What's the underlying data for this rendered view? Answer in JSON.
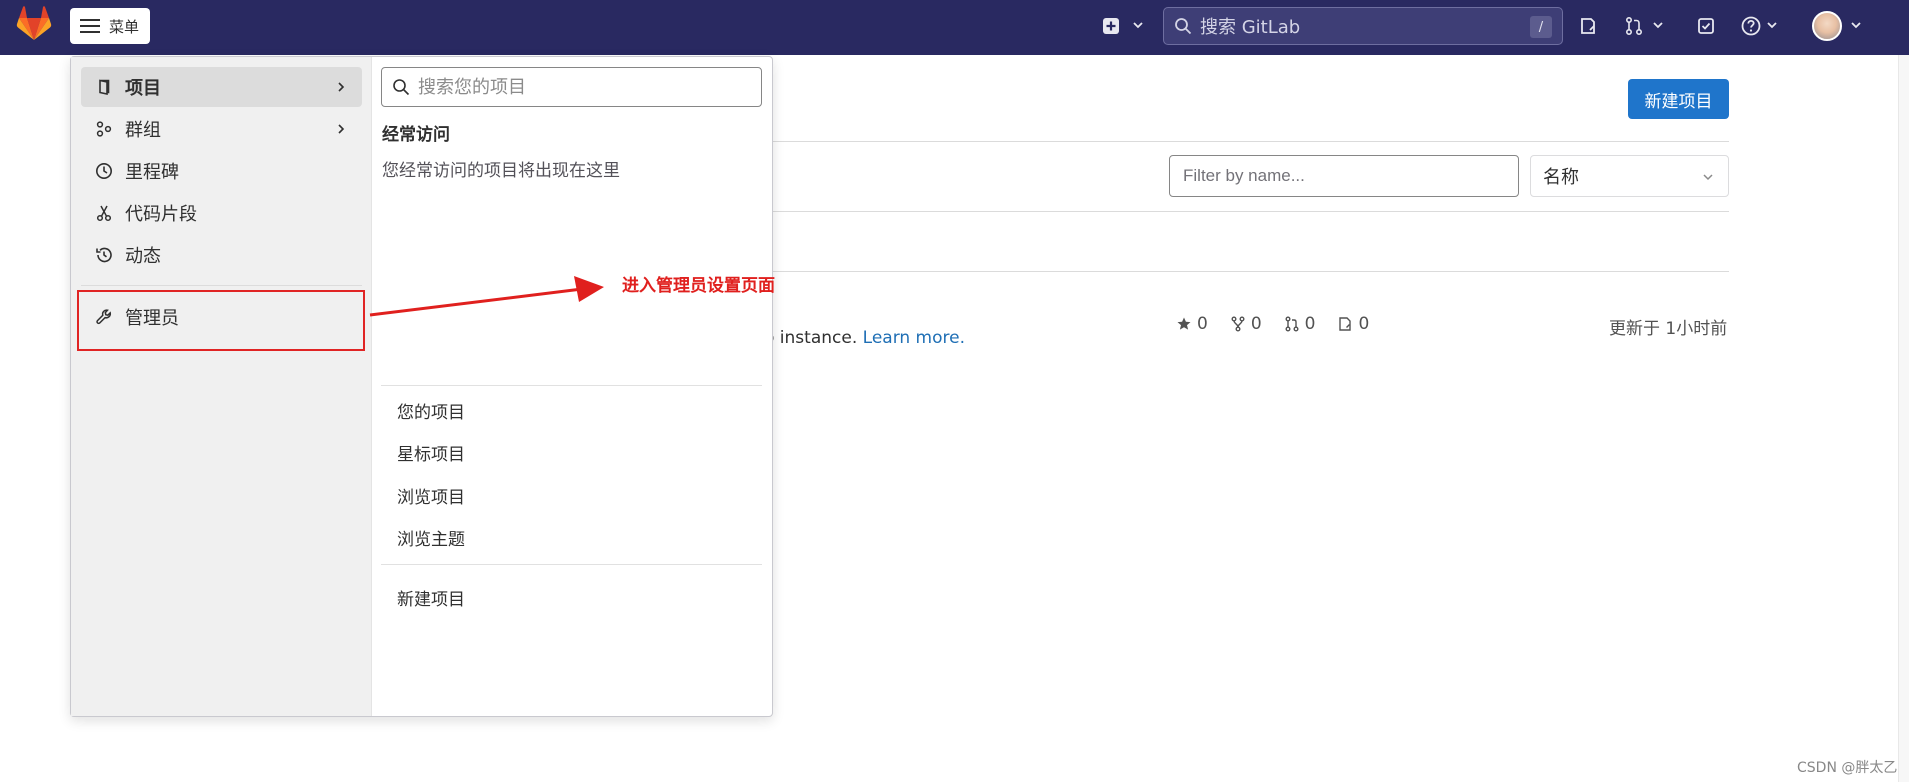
{
  "topbar": {
    "menu_label": "菜单",
    "search_placeholder": "搜索 GitLab",
    "search_shortcut": "/",
    "background_color": "#292961"
  },
  "page": {
    "new_project_button": "新建项目",
    "filter_placeholder": "Filter by name...",
    "sort_selected": "名称",
    "info_text_prefix": "o instance. ",
    "info_link": "Learn more.",
    "stats": [
      {
        "icon": "star-icon",
        "value": "0"
      },
      {
        "icon": "fork-icon",
        "value": "0"
      },
      {
        "icon": "merge-request-icon",
        "value": "0"
      },
      {
        "icon": "issues-icon",
        "value": "0"
      }
    ],
    "updated_text": "更新于 1小时前",
    "accent_color": "#1f75cb"
  },
  "dropdown": {
    "left_items": [
      {
        "label": "项目",
        "icon": "project-icon"
      },
      {
        "label": "群组",
        "icon": "group-icon"
      },
      {
        "label": "里程碑",
        "icon": "milestone-icon"
      },
      {
        "label": "代码片段",
        "icon": "snippet-icon"
      },
      {
        "label": "动态",
        "icon": "activity-icon"
      },
      {
        "label": "管理员",
        "icon": "wrench-icon"
      }
    ],
    "search_placeholder": "搜索您的项目",
    "frequent_heading": "经常访问",
    "frequent_empty": "您经常访问的项目将出现在这里",
    "links": [
      "您的项目",
      "星标项目",
      "浏览项目",
      "浏览主题"
    ],
    "new_project_link": "新建项目"
  },
  "annotation": {
    "text": "进入管理员设置页面",
    "color": "#e0201e"
  },
  "watermark": "CSDN @胖太乙"
}
